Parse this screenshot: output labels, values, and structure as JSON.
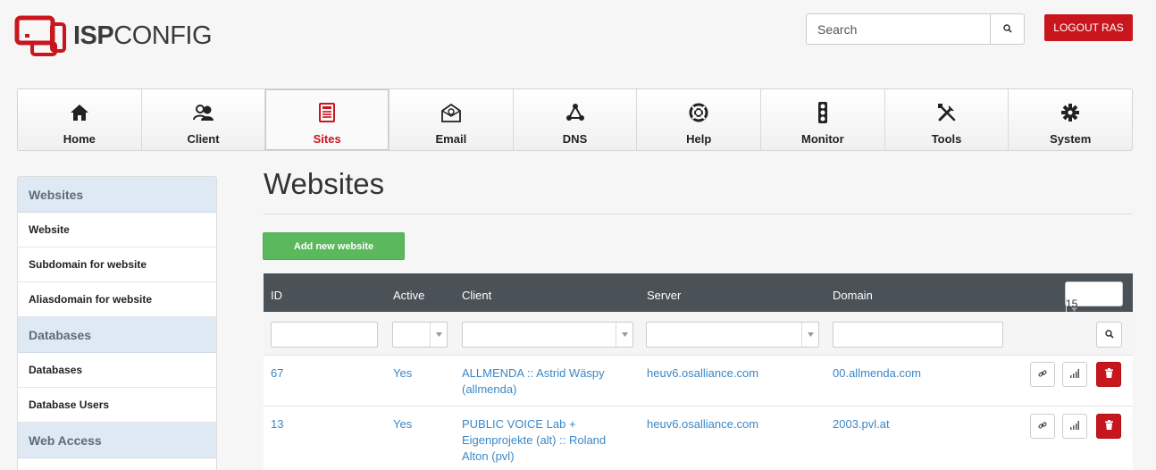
{
  "header": {
    "logo_bold": "ISP",
    "logo_light": "CONFIG",
    "search_placeholder": "Search",
    "logout_label": "LOGOUT RAS"
  },
  "nav": {
    "items": [
      {
        "label": "Home",
        "icon": "home-icon"
      },
      {
        "label": "Client",
        "icon": "users-icon"
      },
      {
        "label": "Sites",
        "icon": "sites-icon",
        "active": true
      },
      {
        "label": "Email",
        "icon": "email-icon"
      },
      {
        "label": "DNS",
        "icon": "dns-icon"
      },
      {
        "label": "Help",
        "icon": "lifebuoy-icon"
      },
      {
        "label": "Monitor",
        "icon": "traffic-light-icon"
      },
      {
        "label": "Tools",
        "icon": "tools-icon"
      },
      {
        "label": "System",
        "icon": "gear-icon"
      }
    ]
  },
  "sidebar": {
    "sections": [
      {
        "title": "Websites",
        "items": [
          "Website",
          "Subdomain for website",
          "Aliasdomain for website"
        ]
      },
      {
        "title": "Databases",
        "items": [
          "Databases",
          "Database Users"
        ]
      },
      {
        "title": "Web Access",
        "items": []
      }
    ]
  },
  "main": {
    "title": "Websites",
    "add_button": "Add new website",
    "table": {
      "columns": [
        "ID",
        "Active",
        "Client",
        "Server",
        "Domain"
      ],
      "per_page": "15",
      "rows": [
        {
          "id": "67",
          "active": "Yes",
          "client": "ALLMENDA :: Astrid Wäspy (allmenda)",
          "server": "heuv6.osalliance.com",
          "domain": "00.allmenda.com"
        },
        {
          "id": "13",
          "active": "Yes",
          "client": "PUBLIC VOICE Lab + Eigenprojekte (alt) :: Roland Alton (pvl)",
          "server": "heuv6.osalliance.com",
          "domain": "2003.pvl.at"
        }
      ]
    }
  },
  "colors": {
    "brand_red": "#c9151e",
    "add_green": "#5cb85c",
    "table_header": "#4a5157",
    "link_blue": "#3a87c7",
    "sidebar_header": "#dfe9f3"
  }
}
